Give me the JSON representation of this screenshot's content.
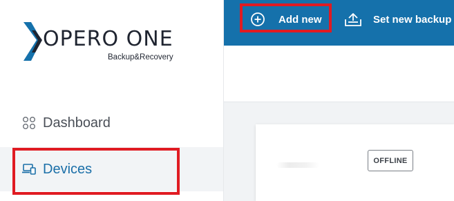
{
  "brand": {
    "name": "OPERO ONE",
    "tagline": "Backup&Recovery",
    "colors": {
      "primary": "#1571ab",
      "mark_dark": "#1f2430",
      "highlight": "#e01b22"
    }
  },
  "sidebar": {
    "items": [
      {
        "label": "Dashboard",
        "icon": "dashboard-grid-icon"
      },
      {
        "label": "Devices",
        "icon": "devices-icon",
        "active": true
      }
    ]
  },
  "toolbar": {
    "add_new_label": "Add new",
    "add_new_icon": "plus-circle-icon",
    "set_backup_label": "Set new backup",
    "set_backup_icon": "cloud-upload-icon"
  },
  "device_card": {
    "status": "OFFLINE"
  }
}
